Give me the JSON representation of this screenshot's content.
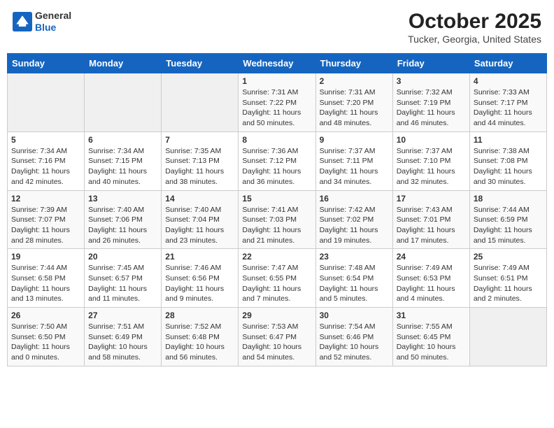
{
  "header": {
    "logo_general": "General",
    "logo_blue": "Blue",
    "month_title": "October 2025",
    "location": "Tucker, Georgia, United States"
  },
  "weekdays": [
    "Sunday",
    "Monday",
    "Tuesday",
    "Wednesday",
    "Thursday",
    "Friday",
    "Saturday"
  ],
  "weeks": [
    [
      {
        "day": "",
        "info": ""
      },
      {
        "day": "",
        "info": ""
      },
      {
        "day": "",
        "info": ""
      },
      {
        "day": "1",
        "info": "Sunrise: 7:31 AM\nSunset: 7:22 PM\nDaylight: 11 hours\nand 50 minutes."
      },
      {
        "day": "2",
        "info": "Sunrise: 7:31 AM\nSunset: 7:20 PM\nDaylight: 11 hours\nand 48 minutes."
      },
      {
        "day": "3",
        "info": "Sunrise: 7:32 AM\nSunset: 7:19 PM\nDaylight: 11 hours\nand 46 minutes."
      },
      {
        "day": "4",
        "info": "Sunrise: 7:33 AM\nSunset: 7:17 PM\nDaylight: 11 hours\nand 44 minutes."
      }
    ],
    [
      {
        "day": "5",
        "info": "Sunrise: 7:34 AM\nSunset: 7:16 PM\nDaylight: 11 hours\nand 42 minutes."
      },
      {
        "day": "6",
        "info": "Sunrise: 7:34 AM\nSunset: 7:15 PM\nDaylight: 11 hours\nand 40 minutes."
      },
      {
        "day": "7",
        "info": "Sunrise: 7:35 AM\nSunset: 7:13 PM\nDaylight: 11 hours\nand 38 minutes."
      },
      {
        "day": "8",
        "info": "Sunrise: 7:36 AM\nSunset: 7:12 PM\nDaylight: 11 hours\nand 36 minutes."
      },
      {
        "day": "9",
        "info": "Sunrise: 7:37 AM\nSunset: 7:11 PM\nDaylight: 11 hours\nand 34 minutes."
      },
      {
        "day": "10",
        "info": "Sunrise: 7:37 AM\nSunset: 7:10 PM\nDaylight: 11 hours\nand 32 minutes."
      },
      {
        "day": "11",
        "info": "Sunrise: 7:38 AM\nSunset: 7:08 PM\nDaylight: 11 hours\nand 30 minutes."
      }
    ],
    [
      {
        "day": "12",
        "info": "Sunrise: 7:39 AM\nSunset: 7:07 PM\nDaylight: 11 hours\nand 28 minutes."
      },
      {
        "day": "13",
        "info": "Sunrise: 7:40 AM\nSunset: 7:06 PM\nDaylight: 11 hours\nand 26 minutes."
      },
      {
        "day": "14",
        "info": "Sunrise: 7:40 AM\nSunset: 7:04 PM\nDaylight: 11 hours\nand 23 minutes."
      },
      {
        "day": "15",
        "info": "Sunrise: 7:41 AM\nSunset: 7:03 PM\nDaylight: 11 hours\nand 21 minutes."
      },
      {
        "day": "16",
        "info": "Sunrise: 7:42 AM\nSunset: 7:02 PM\nDaylight: 11 hours\nand 19 minutes."
      },
      {
        "day": "17",
        "info": "Sunrise: 7:43 AM\nSunset: 7:01 PM\nDaylight: 11 hours\nand 17 minutes."
      },
      {
        "day": "18",
        "info": "Sunrise: 7:44 AM\nSunset: 6:59 PM\nDaylight: 11 hours\nand 15 minutes."
      }
    ],
    [
      {
        "day": "19",
        "info": "Sunrise: 7:44 AM\nSunset: 6:58 PM\nDaylight: 11 hours\nand 13 minutes."
      },
      {
        "day": "20",
        "info": "Sunrise: 7:45 AM\nSunset: 6:57 PM\nDaylight: 11 hours\nand 11 minutes."
      },
      {
        "day": "21",
        "info": "Sunrise: 7:46 AM\nSunset: 6:56 PM\nDaylight: 11 hours\nand 9 minutes."
      },
      {
        "day": "22",
        "info": "Sunrise: 7:47 AM\nSunset: 6:55 PM\nDaylight: 11 hours\nand 7 minutes."
      },
      {
        "day": "23",
        "info": "Sunrise: 7:48 AM\nSunset: 6:54 PM\nDaylight: 11 hours\nand 5 minutes."
      },
      {
        "day": "24",
        "info": "Sunrise: 7:49 AM\nSunset: 6:53 PM\nDaylight: 11 hours\nand 4 minutes."
      },
      {
        "day": "25",
        "info": "Sunrise: 7:49 AM\nSunset: 6:51 PM\nDaylight: 11 hours\nand 2 minutes."
      }
    ],
    [
      {
        "day": "26",
        "info": "Sunrise: 7:50 AM\nSunset: 6:50 PM\nDaylight: 11 hours\nand 0 minutes."
      },
      {
        "day": "27",
        "info": "Sunrise: 7:51 AM\nSunset: 6:49 PM\nDaylight: 10 hours\nand 58 minutes."
      },
      {
        "day": "28",
        "info": "Sunrise: 7:52 AM\nSunset: 6:48 PM\nDaylight: 10 hours\nand 56 minutes."
      },
      {
        "day": "29",
        "info": "Sunrise: 7:53 AM\nSunset: 6:47 PM\nDaylight: 10 hours\nand 54 minutes."
      },
      {
        "day": "30",
        "info": "Sunrise: 7:54 AM\nSunset: 6:46 PM\nDaylight: 10 hours\nand 52 minutes."
      },
      {
        "day": "31",
        "info": "Sunrise: 7:55 AM\nSunset: 6:45 PM\nDaylight: 10 hours\nand 50 minutes."
      },
      {
        "day": "",
        "info": ""
      }
    ]
  ]
}
